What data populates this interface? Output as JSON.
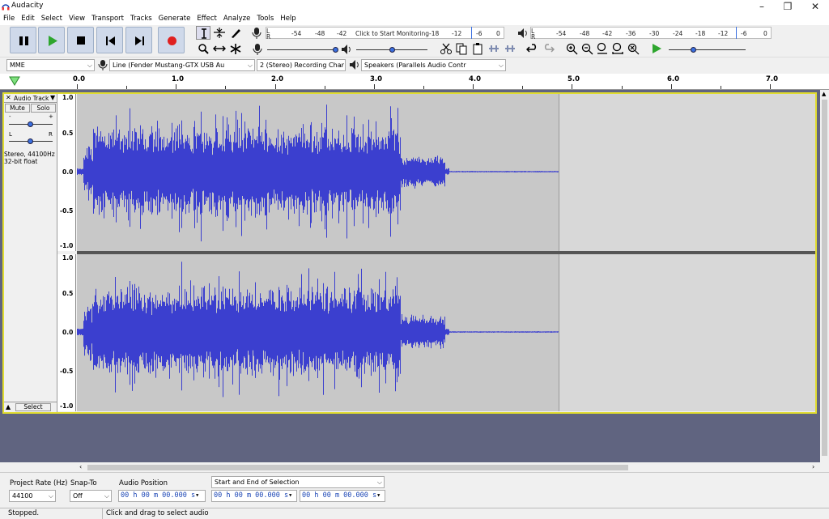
{
  "window": {
    "title": "Audacity"
  },
  "menu": [
    "File",
    "Edit",
    "Select",
    "View",
    "Transport",
    "Tracks",
    "Generate",
    "Effect",
    "Analyze",
    "Tools",
    "Help"
  ],
  "transport": {
    "buttons": [
      {
        "name": "pause",
        "icon": "pause-icon"
      },
      {
        "name": "play",
        "icon": "play-icon"
      },
      {
        "name": "stop",
        "icon": "stop-icon"
      },
      {
        "name": "skip-start",
        "icon": "skip-to-start-icon"
      },
      {
        "name": "skip-end",
        "icon": "skip-to-end-icon"
      },
      {
        "name": "record",
        "icon": "record-icon"
      }
    ],
    "colors": {
      "play": "#2ea62e",
      "record": "#e02020",
      "button_bg": "#cfd9ea"
    }
  },
  "recording_meter": {
    "scale": [
      "L",
      "R",
      "-54",
      "-48",
      "-42",
      "Click to Start Monitoring",
      "-18",
      "-12",
      "-6",
      "0"
    ]
  },
  "playback_meter": {
    "scale": [
      "L",
      "R",
      "-54",
      "-48",
      "-42",
      "-36",
      "-30",
      "-24",
      "-18",
      "-12",
      "-6",
      "0"
    ]
  },
  "devices": {
    "host": "MME",
    "recording_device": "Line (Fender Mustang-GTX USB Au",
    "channels": "2 (Stereo) Recording Char",
    "playback_device": "Speakers (Parallels Audio Contr"
  },
  "timeline": {
    "labels": [
      "0.0",
      "1.0",
      "2.0",
      "3.0",
      "4.0",
      "5.0",
      "6.0",
      "7.0"
    ]
  },
  "track": {
    "name": "Audio Track",
    "mute_label": "Mute",
    "solo_label": "Solo",
    "gain_minus": "-",
    "gain_plus": "+",
    "pan_left": "L",
    "pan_right": "R",
    "info_rate": "Stereo, 44100Hz",
    "info_format": "32-bit float",
    "select_label": "Select",
    "amplitude_labels": [
      "1.0",
      "0.5",
      "0.0",
      "-0.5",
      "-1.0"
    ],
    "wave_color": "#3b3fcf"
  },
  "selection_toolbar": {
    "project_rate_label": "Project Rate (Hz)",
    "project_rate_value": "44100",
    "snap_to_label": "Snap-To",
    "snap_to_value": "Off",
    "audio_position_label": "Audio Position",
    "audio_position_value": "00 h 00 m 00.000 s",
    "selection_mode": "Start and End of Selection",
    "selection_start": "00 h 00 m 00.000 s",
    "selection_end": "00 h 00 m 00.000 s"
  },
  "status": {
    "state": "Stopped.",
    "hint": "Click and drag to select audio"
  }
}
